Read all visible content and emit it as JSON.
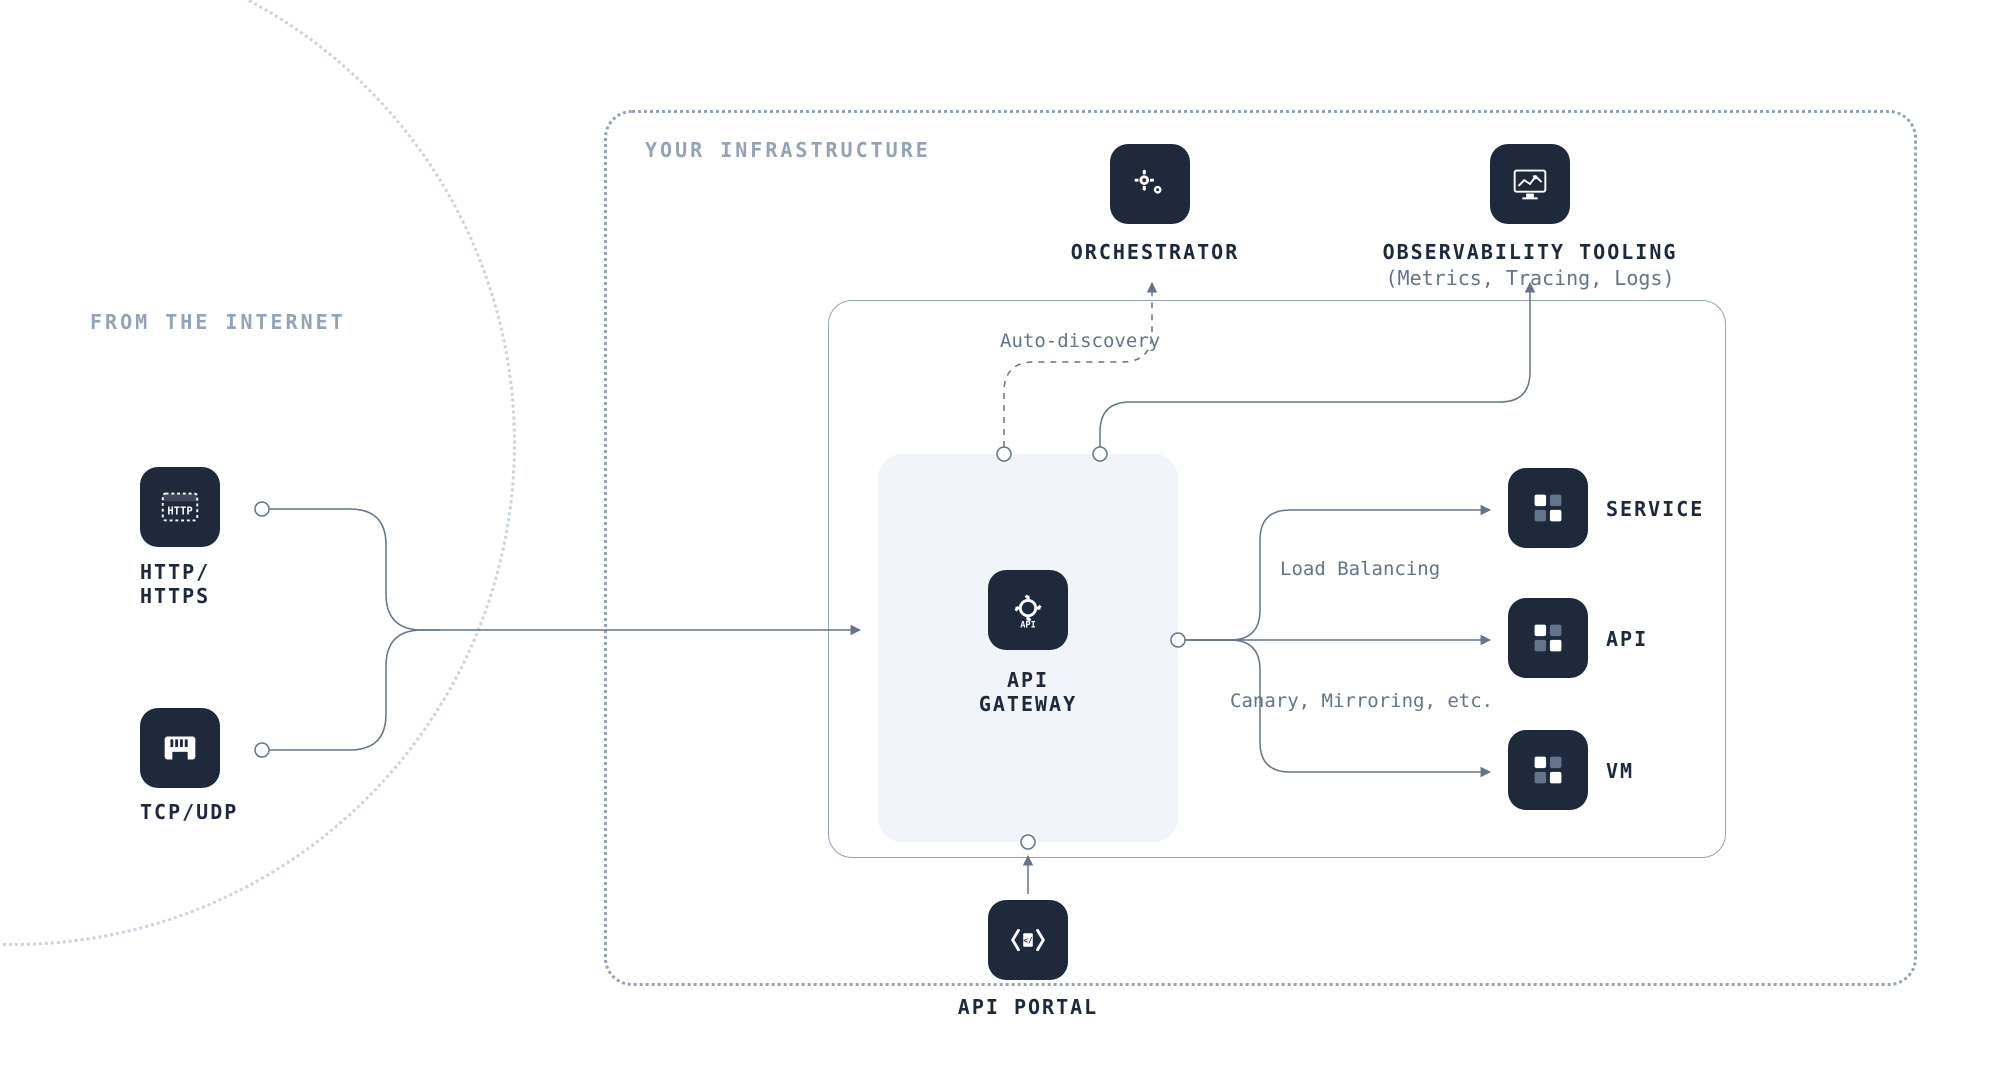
{
  "sections": {
    "internet": "FROM THE INTERNET",
    "infra": "YOUR INFRASTRUCTURE"
  },
  "nodes": {
    "http": {
      "label": "HTTP/\nHTTPS",
      "icon": "http-icon"
    },
    "tcp": {
      "label": "TCP/UDP",
      "icon": "ethernet-icon"
    },
    "orchestrator": {
      "label": "ORCHESTRATOR",
      "icon": "gears-icon"
    },
    "observability": {
      "label": "OBSERVABILITY TOOLING",
      "sublabel": "(Metrics, Tracing, Logs)",
      "icon": "monitor-chart-icon"
    },
    "gateway": {
      "label": "API\nGATEWAY",
      "icon": "gear-api-icon"
    },
    "portal": {
      "label": "API PORTAL",
      "icon": "code-brackets-icon"
    },
    "service": {
      "label": "SERVICE",
      "icon": "grid-icon"
    },
    "api": {
      "label": "API",
      "icon": "grid-icon"
    },
    "vm": {
      "label": "VM",
      "icon": "grid-icon"
    }
  },
  "edges": {
    "autodiscovery": "Auto-discovery",
    "loadbalancing": "Load Balancing",
    "canary": "Canary, Mirroring, etc."
  }
}
